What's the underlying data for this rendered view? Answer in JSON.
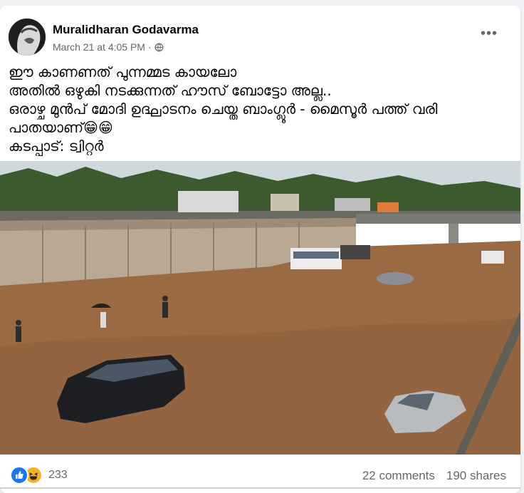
{
  "post": {
    "author": "Muralidharan Godavarma",
    "timestamp": "March 21 at 4:05 PM",
    "privacy_separator": "·",
    "privacy_icon": "globe-icon",
    "more_icon": "more-options-icon",
    "text_lines": [
      "ഈ കാണണത് പുന്നമ്മട കായലോ",
      "അതിൽ ഒഴുകി നടക്കുന്നത് ഹൗസ് ബോട്ടോ അല്ല..",
      "ഒരാഴ്ച മുൻപ് മോദി ഉദ്ഘാടനം ചെയ്ത ബാംഗ്ലൂർ - മൈസൂർ പത്ത് വരി",
      "പാതയാണ്😁😁",
      "കടപ്പാട്: ട്വിറ്റർ"
    ]
  },
  "footer": {
    "reaction_icons": [
      "like-icon",
      "haha-icon"
    ],
    "reaction_count": "233",
    "comments": "22 comments",
    "shares": "190 shares"
  },
  "colors": {
    "name": "#050505",
    "meta": "#65676b",
    "like": "#1877f2",
    "haha": "#f7b125",
    "flood_water": "#9a6a43"
  }
}
